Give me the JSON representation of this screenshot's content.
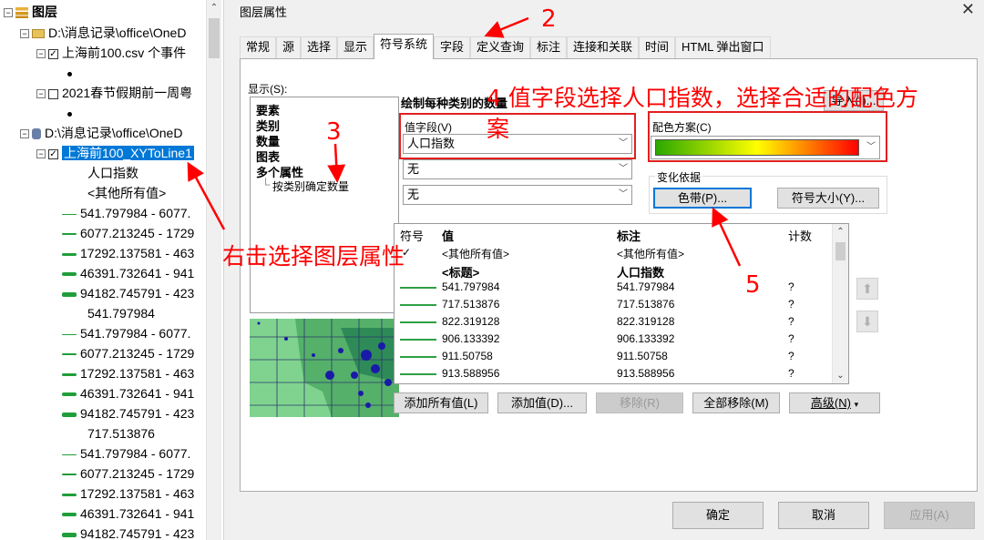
{
  "toc": {
    "root_label": "图层",
    "rows": [
      {
        "kind": "folder",
        "label": "D:\\消息记录\\office\\OneD"
      },
      {
        "kind": "layer",
        "label": "上海前100.csv 个事件",
        "checked": true
      },
      {
        "kind": "layer",
        "label": "2021春节假期前一周粤",
        "checked": false
      },
      {
        "kind": "db",
        "label": "D:\\消息记录\\office\\OneD"
      },
      {
        "kind": "layer-selected",
        "label": "上海前100_XYToLine1",
        "checked": true
      },
      {
        "kind": "text",
        "label": "人口指数"
      },
      {
        "kind": "text",
        "label": "<其他所有值>"
      },
      {
        "kind": "range",
        "label": "541.797984 - 6077."
      },
      {
        "kind": "range",
        "label": "6077.213245 - 1729"
      },
      {
        "kind": "range",
        "label": "17292.137581 - 463"
      },
      {
        "kind": "range",
        "label": "46391.732641 - 941"
      },
      {
        "kind": "range",
        "label": "94182.745791 - 423"
      },
      {
        "kind": "text",
        "label": "541.797984"
      },
      {
        "kind": "range",
        "label": "541.797984 - 6077."
      },
      {
        "kind": "range",
        "label": "6077.213245 - 1729"
      },
      {
        "kind": "range",
        "label": "17292.137581 - 463"
      },
      {
        "kind": "range",
        "label": "46391.732641 - 941"
      },
      {
        "kind": "range",
        "label": "94182.745791 - 423"
      },
      {
        "kind": "text",
        "label": "717.513876"
      },
      {
        "kind": "range",
        "label": "541.797984 - 6077."
      },
      {
        "kind": "range",
        "label": "6077.213245 - 1729"
      },
      {
        "kind": "range",
        "label": "17292.137581 - 463"
      },
      {
        "kind": "range",
        "label": "46391.732641 - 941"
      },
      {
        "kind": "range",
        "label": "94182.745791 - 423"
      }
    ]
  },
  "dialog": {
    "title": "图层属性",
    "close": "✕",
    "tabs": [
      "常规",
      "源",
      "选择",
      "显示",
      "符号系统",
      "字段",
      "定义查询",
      "标注",
      "连接和关联",
      "时间",
      "HTML 弹出窗口"
    ],
    "active_tab": "符号系统",
    "show_label": "显示(S):",
    "show_items": [
      "要素",
      "类别",
      "数量",
      "图表",
      "多个属性"
    ],
    "show_subitem": "按类别确定数量",
    "heading": "绘制每种类别的数量",
    "import_button": "导入(I)...",
    "value_field_label": "值字段(V)",
    "value_field_value": "人口指数",
    "combo2_value": "无",
    "combo3_value": "无",
    "color_scheme_label": "配色方案(C)",
    "vary_by_label": "变化依据",
    "color_ramp_button": "色带(P)...",
    "symbol_size_button": "符号大小(Y)...",
    "table": {
      "headers": [
        "符号",
        "值",
        "标注",
        "计数"
      ],
      "rows": [
        {
          "value": "<其他所有值>",
          "label": "<其他所有值>",
          "count": "",
          "check": true
        },
        {
          "value": "<标题>",
          "label": "人口指数",
          "count": "",
          "bold": true
        },
        {
          "value": "541.797984",
          "label": "541.797984",
          "count": "?"
        },
        {
          "value": "717.513876",
          "label": "717.513876",
          "count": "?"
        },
        {
          "value": "822.319128",
          "label": "822.319128",
          "count": "?"
        },
        {
          "value": "906.133392",
          "label": "906.133392",
          "count": "?"
        },
        {
          "value": "911.50758",
          "label": "911.50758",
          "count": "?"
        },
        {
          "value": "913.588956",
          "label": "913.588956",
          "count": "?"
        }
      ]
    },
    "buttons_row": [
      "添加所有值(L)",
      "添加值(D)...",
      "移除(R)",
      "全部移除(M)",
      "高级(N)"
    ],
    "footer": {
      "ok": "确定",
      "cancel": "取消",
      "apply": "应用(A)"
    },
    "colors": {
      "ramp_start": "#2aa800",
      "ramp_mid": "#ffff00",
      "ramp_end": "#ff0000"
    }
  },
  "annotations": {
    "step2": "2",
    "step3": "3",
    "step4": "4 值字段选择人口指数，选择合适的配色方",
    "step4_cont": "案",
    "step5": "5",
    "right_click": "右击选择图层属性"
  }
}
